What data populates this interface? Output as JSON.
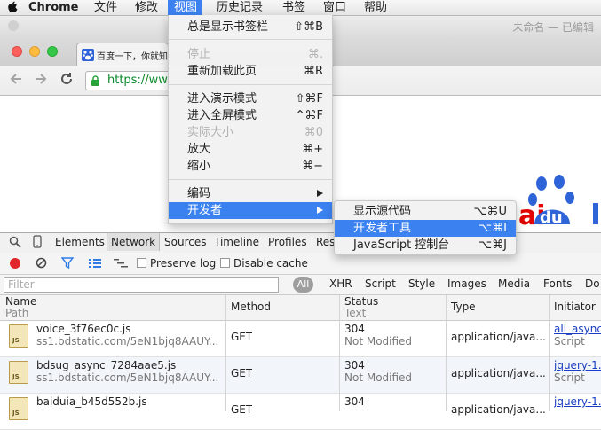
{
  "menubar": {
    "app": "Chrome",
    "items": [
      "文件",
      "修改",
      "视图",
      "历史记录",
      "书签",
      "窗口",
      "帮助"
    ],
    "active": "视图"
  },
  "window": {
    "title": "未命名 — 已编辑"
  },
  "tab": {
    "title": "百度一下，你就知"
  },
  "address": {
    "url": "https://ww"
  },
  "view_menu": {
    "items": [
      {
        "label": "总是显示书签栏",
        "shortcut": "⇧⌘B",
        "disabled": false
      },
      {
        "label": "停止",
        "shortcut": "⌘.",
        "disabled": true
      },
      {
        "label": "重新加载此页",
        "shortcut": "⌘R",
        "disabled": false
      },
      {
        "label": "进入演示模式",
        "shortcut": "⇧⌘F",
        "disabled": false
      },
      {
        "label": "进入全屏模式",
        "shortcut": "^⌘F",
        "disabled": false
      },
      {
        "label": "实际大小",
        "shortcut": "⌘0",
        "disabled": true
      },
      {
        "label": "放大",
        "shortcut": "⌘+",
        "disabled": false
      },
      {
        "label": "缩小",
        "shortcut": "⌘−",
        "disabled": false
      },
      {
        "label": "编码",
        "shortcut": "",
        "disabled": false
      },
      {
        "label": "开发者",
        "shortcut": "",
        "disabled": false
      }
    ]
  },
  "developer_menu": {
    "items": [
      {
        "label": "显示源代码",
        "shortcut": "⌥⌘U"
      },
      {
        "label": "开发者工具",
        "shortcut": "⌥⌘I"
      },
      {
        "label": "JavaScript 控制台",
        "shortcut": "⌥⌘J"
      }
    ]
  },
  "devtools": {
    "tabs": [
      "Elements",
      "Network",
      "Sources",
      "Timeline",
      "Profiles",
      "Res"
    ],
    "selected_tab": "Network",
    "preserve_log": "Preserve log",
    "disable_cache": "Disable cache",
    "filter_placeholder": "Filter",
    "filter_types": [
      "All",
      "XHR",
      "Script",
      "Style",
      "Images",
      "Media",
      "Fonts",
      "Do"
    ],
    "columns": {
      "name": "Name",
      "path": "Path",
      "method": "Method",
      "status": "Status",
      "text": "Text",
      "type": "Type",
      "initiator": "Initiator"
    },
    "rows": [
      {
        "name": "voice_3f76ec0c.js",
        "path": "ss1.bdstatic.com/5eN1bjq8AAUY...",
        "method": "GET",
        "status": "304",
        "status_text": "Not Modified",
        "type": "application/java...",
        "initiator": "all_async",
        "initiator_sub": "Script"
      },
      {
        "name": "bdsug_async_7284aae5.js",
        "path": "ss1.bdstatic.com/5eN1bjq8AAUY...",
        "method": "GET",
        "status": "304",
        "status_text": "Not Modified",
        "type": "application/java...",
        "initiator": "jquery-1.",
        "initiator_sub": "Script"
      },
      {
        "name": "baiduia_b45d552b.js",
        "path": "",
        "method": "GET",
        "status": "304",
        "status_text": "",
        "type": "application/java...",
        "initiator": "jquery-1.",
        "initiator_sub": ""
      }
    ]
  },
  "baidu_logo": {
    "text": "du",
    "partial": "ai"
  },
  "colors": {
    "menu_highlight": "#3b82f0",
    "record": "#e0262a",
    "baidu_blue": "#2f64d8",
    "baidu_red": "#e10602"
  }
}
